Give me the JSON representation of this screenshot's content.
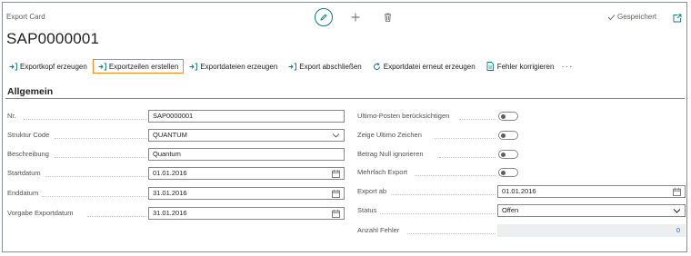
{
  "header": {
    "page_title": "Export Card",
    "record_title": "SAP0000001",
    "saved_label": "Gespeichert"
  },
  "actions": [
    {
      "label": "Exportkopf erzeugen"
    },
    {
      "label": "Exportzeilen erstellen"
    },
    {
      "label": "Exportdateien erzeugen"
    },
    {
      "label": "Export abschließen"
    },
    {
      "label": "Exportdatei erneut erzeugen"
    },
    {
      "label": "Fehler korrigieren"
    }
  ],
  "more_label": "···",
  "section": {
    "title": "Allgemein"
  },
  "left_fields": {
    "nr": {
      "label": "Nr.",
      "value": "SAP0000001"
    },
    "struktur_code": {
      "label": "Struktur Code",
      "value": "QUANTUM"
    },
    "beschreibung": {
      "label": "Beschreibung",
      "value": "Quantum"
    },
    "startdatum": {
      "label": "Startdatum",
      "value": "01.01.2016"
    },
    "enddatum": {
      "label": "Enddatum",
      "value": "31.01.2016"
    },
    "vorgabe_exportdatum": {
      "label": "Vorgabe Exportdatum",
      "value": "31.01.2016"
    }
  },
  "right_fields": {
    "ultimo_posten": {
      "label": "Ultimo-Posten berücksichtigen",
      "value": "Aus"
    },
    "zeige_ultimo": {
      "label": "Zeige Ultimo Zeichen",
      "value": "Aus"
    },
    "betrag_null": {
      "label": "Betrag Null ignorieren",
      "value": "Aus"
    },
    "mehrfach_export": {
      "label": "Mehrfach Export",
      "value": "Aus"
    },
    "export_ab": {
      "label": "Export ab",
      "value": "01.01.2016"
    },
    "status": {
      "label": "Status",
      "value": "Offen"
    },
    "anzahl_fehler": {
      "label": "Anzahl Fehler",
      "value": "0"
    }
  },
  "colors": {
    "accent": "#0e7a7b",
    "highlight_border": "#ef8a1a",
    "link_blue": "#0f6cbd"
  }
}
